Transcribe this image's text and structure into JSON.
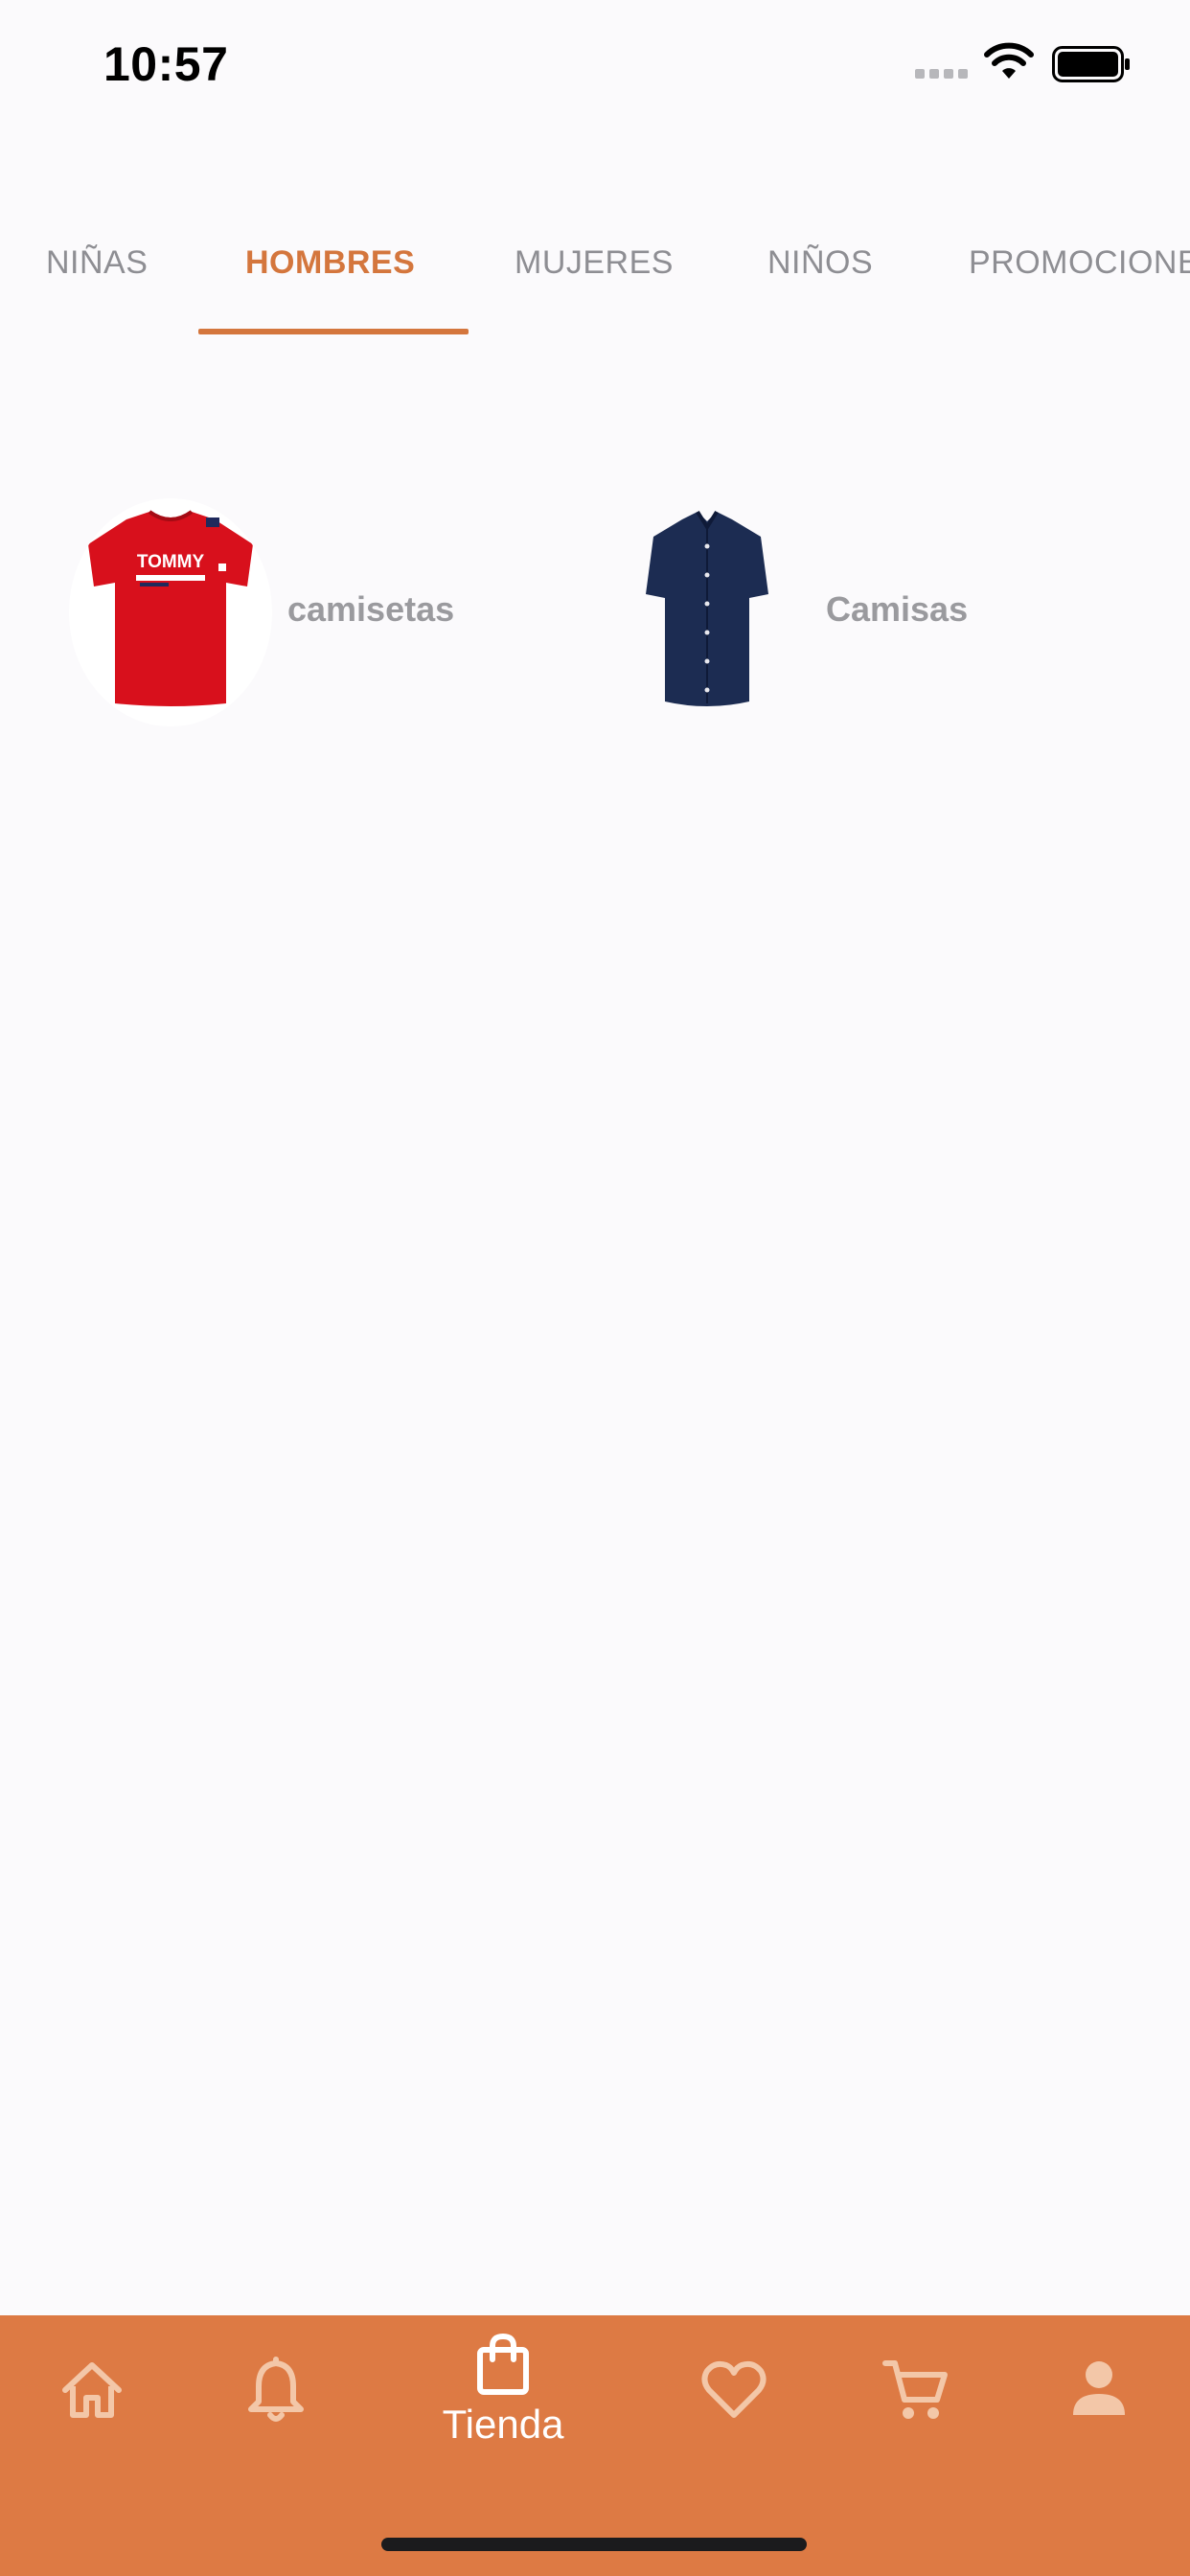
{
  "status_bar": {
    "time": "10:57",
    "icons": [
      "cellular-signal-icon",
      "wifi-icon",
      "battery-icon"
    ]
  },
  "tabs": {
    "items": [
      {
        "label": "NIÑAS",
        "active": false
      },
      {
        "label": "HOMBRES",
        "active": true
      },
      {
        "label": "MUJERES",
        "active": false
      },
      {
        "label": "NIÑOS",
        "active": false
      },
      {
        "label": "PROMOCIONES",
        "active": false
      }
    ]
  },
  "categories": [
    {
      "label": "camisetas",
      "image": "red-tshirt-image"
    },
    {
      "label": "Camisas",
      "image": "navy-shirt-image"
    }
  ],
  "tshirt_brand": "TOMMY",
  "bottom_nav": {
    "items": [
      {
        "icon": "home-icon",
        "label": ""
      },
      {
        "icon": "bell-icon",
        "label": ""
      },
      {
        "icon": "shopping-bag-icon",
        "label": "Tienda",
        "active": true
      },
      {
        "icon": "heart-icon",
        "label": ""
      },
      {
        "icon": "cart-icon",
        "label": ""
      },
      {
        "icon": "person-icon",
        "label": ""
      }
    ]
  },
  "colors": {
    "accent": "#d4763d",
    "nav_background": "#dd7a44",
    "background": "#fbfafc",
    "inactive_text": "#8e8e93"
  }
}
